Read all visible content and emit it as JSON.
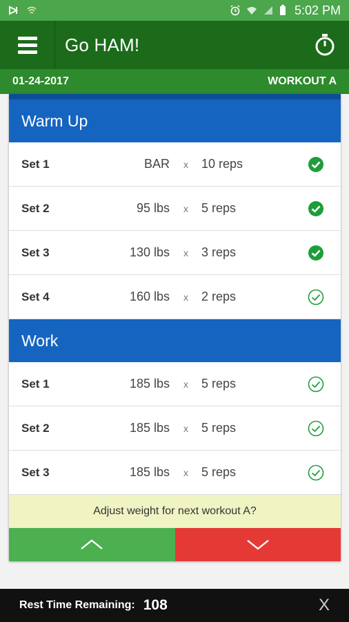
{
  "status": {
    "time": "5:02 PM"
  },
  "app": {
    "title": "Go HAM!"
  },
  "sub": {
    "date": "01-24-2017",
    "workout": "WORKOUT A"
  },
  "sections": [
    {
      "title": "Warm Up",
      "sets": [
        {
          "name": "Set 1",
          "weight": "BAR",
          "x": "x",
          "reps": "10 reps",
          "done": true
        },
        {
          "name": "Set 2",
          "weight": "95 lbs",
          "x": "x",
          "reps": "5 reps",
          "done": true
        },
        {
          "name": "Set 3",
          "weight": "130 lbs",
          "x": "x",
          "reps": "3 reps",
          "done": true
        },
        {
          "name": "Set 4",
          "weight": "160 lbs",
          "x": "x",
          "reps": "2 reps",
          "done": false
        }
      ]
    },
    {
      "title": "Work",
      "sets": [
        {
          "name": "Set 1",
          "weight": "185 lbs",
          "x": "x",
          "reps": "5 reps",
          "done": false
        },
        {
          "name": "Set 2",
          "weight": "185 lbs",
          "x": "x",
          "reps": "5 reps",
          "done": false
        },
        {
          "name": "Set 3",
          "weight": "185 lbs",
          "x": "x",
          "reps": "5 reps",
          "done": false
        }
      ]
    }
  ],
  "adjust": {
    "prompt": "Adjust weight for next workout A?"
  },
  "rest": {
    "label": "Rest Time Remaining:",
    "value": "108",
    "close": "X"
  },
  "colors": {
    "app_bar": "#1b6b1b",
    "status_bar": "#4ca64c",
    "section": "#1565c0",
    "check": "#1e9e3a",
    "up": "#4caf50",
    "down": "#e53935"
  },
  "icons": {
    "menu": "hamburger-icon",
    "timer": "stopwatch-icon",
    "check_done": "filled-check-circle-icon",
    "check_pending": "outline-check-circle-icon"
  }
}
